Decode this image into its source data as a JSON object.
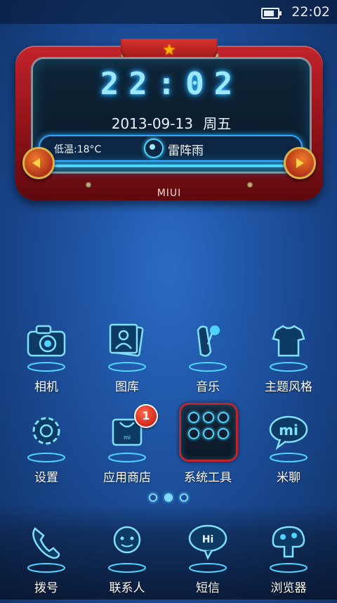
{
  "status_bar": {
    "time": "22:02",
    "battery_level": 0.7
  },
  "widget": {
    "clock": "22:02",
    "date": "2013-09-13",
    "weekday": "周五",
    "low_temp": "低温:18°C",
    "weather": "雷阵雨",
    "brand": "MIUI"
  },
  "apps": [
    {
      "label": "相机",
      "icon": "camera-icon"
    },
    {
      "label": "图库",
      "icon": "gallery-icon"
    },
    {
      "label": "音乐",
      "icon": "music-icon"
    },
    {
      "label": "主题风格",
      "icon": "theme-icon"
    },
    {
      "label": "设置",
      "icon": "gear-icon"
    },
    {
      "label": "应用商店",
      "icon": "store-bag-icon",
      "badge": "1"
    },
    {
      "label": "系统工具",
      "icon": "folder-icon"
    },
    {
      "label": "米聊",
      "icon": "mi-chat-icon"
    }
  ],
  "pager": {
    "pages": 3,
    "current": 2
  },
  "dock": [
    {
      "label": "拨号",
      "icon": "phone-icon"
    },
    {
      "label": "联系人",
      "icon": "contacts-icon"
    },
    {
      "label": "短信",
      "icon": "sms-icon"
    },
    {
      "label": "浏览器",
      "icon": "browser-icon"
    }
  ],
  "colors": {
    "glow": "#4fd4ff",
    "frame_red": "#c1242a",
    "background": "#1d4f9c"
  }
}
